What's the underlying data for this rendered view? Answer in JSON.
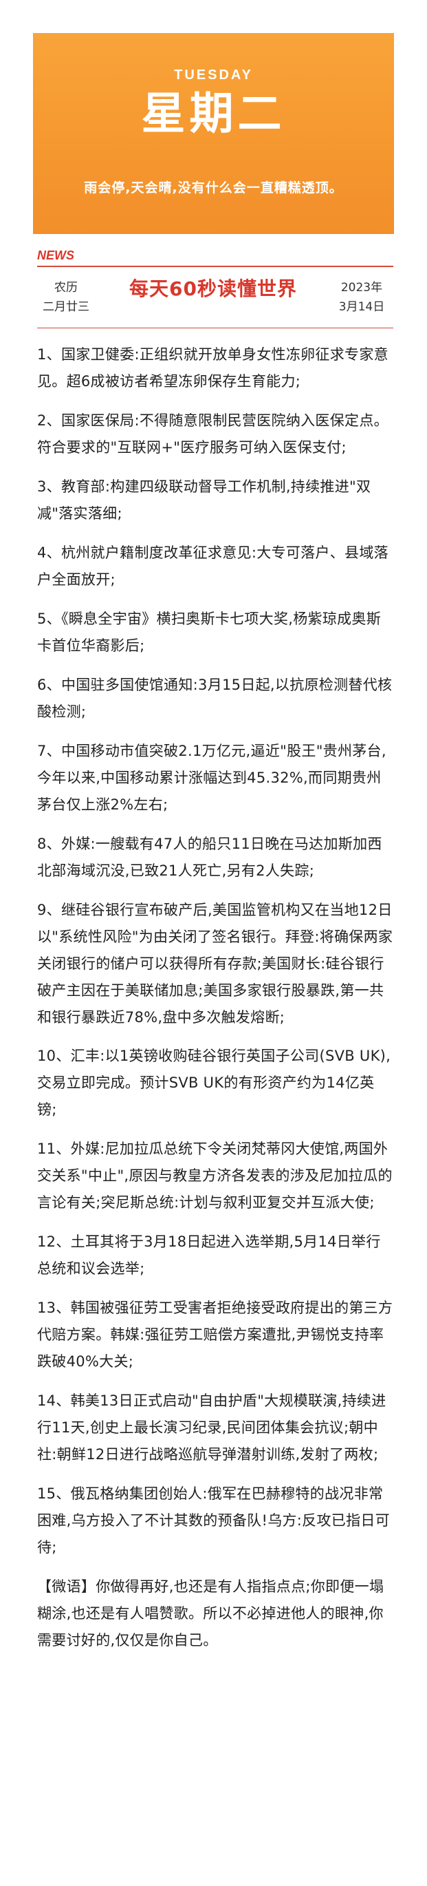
{
  "hero": {
    "day_en": "TUESDAY",
    "day_cn": "星期二",
    "motto": "雨会停,天会晴,没有什么会一直糟糕透顶。"
  },
  "header": {
    "news_tag": "NEWS",
    "lunar_label": "农历",
    "lunar_date": "二月廿三",
    "masthead": "每天60秒读懂世界",
    "year": "2023年",
    "date": "3月14日"
  },
  "colors": {
    "hero_orange": "#f69a31",
    "accent_red": "#d9372b",
    "text": "#222222"
  },
  "items": [
    "1、国家卫健委:正组织就开放单身女性冻卵征求专家意见。超6成被访者希望冻卵保存生育能力;",
    "2、国家医保局:不得随意限制民营医院纳入医保定点。符合要求的\"互联网+\"医疗服务可纳入医保支付;",
    "3、教育部:构建四级联动督导工作机制,持续推进\"双减\"落实落细;",
    "4、杭州就户籍制度改革征求意见:大专可落户、县域落户全面放开;",
    "5、《瞬息全宇宙》横扫奥斯卡七项大奖,杨紫琼成奥斯卡首位华裔影后;",
    "6、中国驻多国使馆通知:3月15日起,以抗原检测替代核酸检测;",
    "7、中国移动市值突破2.1万亿元,逼近\"股王\"贵州茅台,今年以来,中国移动累计涨幅达到45.32%,而同期贵州茅台仅上涨2%左右;",
    "8、外媒:一艘载有47人的船只11日晚在马达加斯加西北部海域沉没,已致21人死亡,另有2人失踪;",
    "9、继硅谷银行宣布破产后,美国监管机构又在当地12日以\"系统性风险\"为由关闭了签名银行。拜登:将确保两家关闭银行的储户可以获得所有存款;美国财长:硅谷银行破产主因在于美联储加息;美国多家银行股暴跌,第一共和银行暴跌近78%,盘中多次触发熔断;",
    "10、汇丰:以1英镑收购硅谷银行英国子公司(SVB UK),交易立即完成。预计SVB UK的有形资产约为14亿英镑;",
    "11、外媒:尼加拉瓜总统下令关闭梵蒂冈大使馆,两国外交关系\"中止\",原因与教皇方济各发表的涉及尼加拉瓜的言论有关;突尼斯总统:计划与叙利亚复交并互派大使;",
    "12、土耳其将于3月18日起进入选举期,5月14日举行总统和议会选举;",
    "13、韩国被强征劳工受害者拒绝接受政府提出的第三方代赔方案。韩媒:强征劳工赔偿方案遭批,尹锡悦支持率跌破40%大关;",
    "14、韩美13日正式启动\"自由护盾\"大规模联演,持续进行11天,创史上最长演习纪录,民间团体集会抗议;朝中社:朝鲜12日进行战略巡航导弹潜射训练,发射了两枚;",
    "15、俄瓦格纳集团创始人:俄军在巴赫穆特的战况非常困难,乌方投入了不计其数的预备队!乌方:反攻已指日可待;",
    "【微语】你做得再好,也还是有人指指点点;你即便一塌糊涂,也还是有人唱赞歌。所以不必掉进他人的眼神,你需要讨好的,仅仅是你自己。"
  ]
}
